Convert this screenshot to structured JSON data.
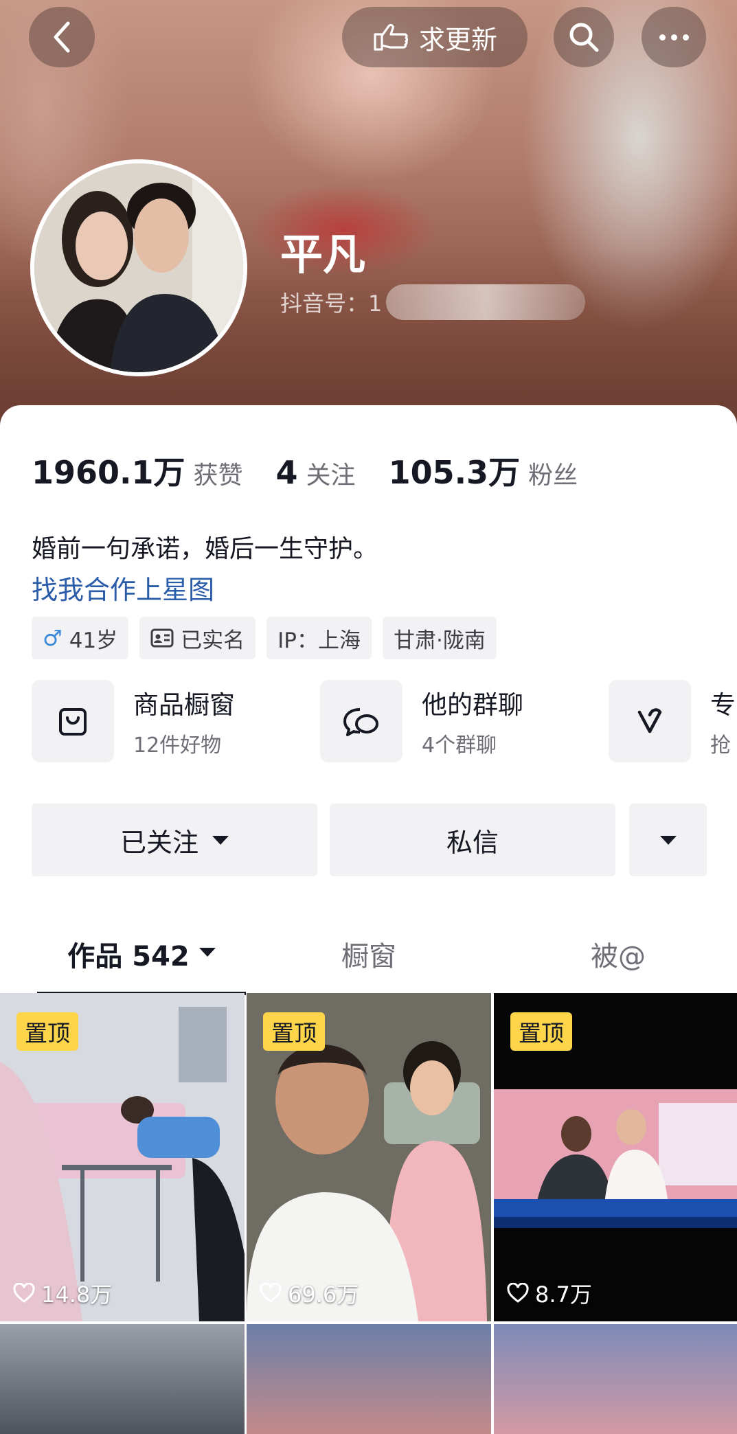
{
  "header": {
    "update_label": "求更新",
    "icons": [
      "chevron-left-icon",
      "hand-point-icon",
      "search-icon",
      "more-icon"
    ]
  },
  "profile": {
    "nickname": "平凡",
    "douyin_id_label": "抖音号：1"
  },
  "stats": [
    {
      "value": "1960.1万",
      "label": "获赞"
    },
    {
      "value": "4",
      "label": "关注"
    },
    {
      "value": "105.3万",
      "label": "粉丝"
    }
  ],
  "bio": "婚前一句承诺，婚后一生守护。",
  "coop_link": "找我合作上星图",
  "tags": {
    "gender_age": "41岁",
    "verified": "已实名",
    "ip": "IP：上海",
    "location": "甘肃·陇南"
  },
  "services": [
    {
      "title": "商品橱窗",
      "sub": "12件好物",
      "icon": "bag-icon"
    },
    {
      "title": "他的群聊",
      "sub": "4个群聊",
      "icon": "chat-bubbles-icon"
    },
    {
      "title": "专",
      "sub": "抢",
      "icon": "heart-v-icon"
    }
  ],
  "actions": {
    "follow": "已关注",
    "message": "私信"
  },
  "tabs": {
    "works": "作品 542",
    "shop": "橱窗",
    "mentioned": "被@"
  },
  "videos": [
    {
      "pinned": "置顶",
      "likes": "14.8万"
    },
    {
      "pinned": "置顶",
      "likes": "69.6万"
    },
    {
      "pinned": "置顶",
      "likes": "8.7万"
    }
  ],
  "colors": {
    "accent_link": "#2a5caa",
    "pin_badge": "#fdd54a",
    "male_icon": "#3d8ad8"
  }
}
